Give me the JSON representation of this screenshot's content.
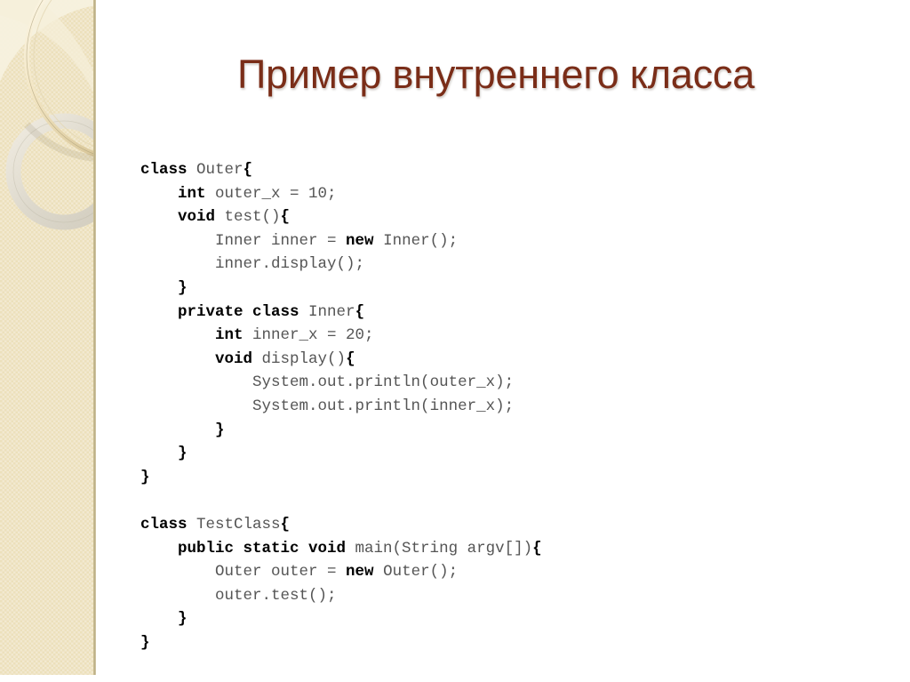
{
  "slide": {
    "title": "Пример внутреннего класса",
    "title_color": "#7a2d18",
    "background_color": "#ffffff"
  },
  "sidebar": {
    "name": "decorative-sidebar",
    "background_color": "#ece0bb",
    "edge_color": "#b9ad85",
    "ring_gold_color": "#f6edd2",
    "ring_gray_color": "#dedad0",
    "wedge_color": "#f5eedb"
  },
  "code_block": {
    "language": "java",
    "lines": [
      {
        "id": "l1",
        "indent": 0,
        "tokens": [
          {
            "t": "class",
            "b": true
          },
          {
            "t": " ",
            "b": false
          },
          {
            "t": "Outer",
            "b": false
          },
          {
            "t": "{",
            "b": true
          }
        ]
      },
      {
        "id": "l2",
        "indent": 1,
        "tokens": [
          {
            "t": "int",
            "b": true
          },
          {
            "t": " outer_x = 10;",
            "b": false
          }
        ]
      },
      {
        "id": "l3",
        "indent": 1,
        "tokens": [
          {
            "t": "void",
            "b": true
          },
          {
            "t": " test()",
            "b": false
          },
          {
            "t": "{",
            "b": true
          }
        ]
      },
      {
        "id": "l4",
        "indent": 2,
        "tokens": [
          {
            "t": "Inner inner = ",
            "b": false
          },
          {
            "t": "new",
            "b": true
          },
          {
            "t": " Inner();",
            "b": false
          }
        ]
      },
      {
        "id": "l5",
        "indent": 2,
        "tokens": [
          {
            "t": "inner.display();",
            "b": false
          }
        ]
      },
      {
        "id": "l6",
        "indent": 1,
        "tokens": [
          {
            "t": "}",
            "b": true
          }
        ]
      },
      {
        "id": "l7",
        "indent": 1,
        "tokens": [
          {
            "t": "private class",
            "b": true
          },
          {
            "t": " Inner",
            "b": false
          },
          {
            "t": "{",
            "b": true
          }
        ]
      },
      {
        "id": "l8",
        "indent": 2,
        "tokens": [
          {
            "t": "int",
            "b": true
          },
          {
            "t": " inner_x = 20;",
            "b": false
          }
        ]
      },
      {
        "id": "l9",
        "indent": 2,
        "tokens": [
          {
            "t": "void",
            "b": true
          },
          {
            "t": " display()",
            "b": false
          },
          {
            "t": "{",
            "b": true
          }
        ]
      },
      {
        "id": "l10",
        "indent": 3,
        "tokens": [
          {
            "t": "System.out.println(outer_x);",
            "b": false
          }
        ]
      },
      {
        "id": "l11",
        "indent": 3,
        "tokens": [
          {
            "t": "System.out.println(inner_x);",
            "b": false
          }
        ]
      },
      {
        "id": "l12",
        "indent": 2,
        "tokens": [
          {
            "t": "}",
            "b": true
          }
        ]
      },
      {
        "id": "l13",
        "indent": 1,
        "tokens": [
          {
            "t": "}",
            "b": true
          }
        ]
      },
      {
        "id": "l14",
        "indent": 0,
        "tokens": [
          {
            "t": "}",
            "b": true
          }
        ]
      },
      {
        "id": "l15",
        "indent": 0,
        "tokens": []
      },
      {
        "id": "l16",
        "indent": 0,
        "tokens": [
          {
            "t": "class",
            "b": true
          },
          {
            "t": " TestClass",
            "b": false
          },
          {
            "t": "{",
            "b": true
          }
        ]
      },
      {
        "id": "l17",
        "indent": 1,
        "tokens": [
          {
            "t": "public static void",
            "b": true
          },
          {
            "t": " main(String argv[])",
            "b": false
          },
          {
            "t": "{",
            "b": true
          }
        ]
      },
      {
        "id": "l18",
        "indent": 2,
        "tokens": [
          {
            "t": "Outer outer = ",
            "b": false
          },
          {
            "t": "new",
            "b": true
          },
          {
            "t": " Outer();",
            "b": false
          }
        ]
      },
      {
        "id": "l19",
        "indent": 2,
        "tokens": [
          {
            "t": "outer.test();",
            "b": false
          }
        ]
      },
      {
        "id": "l20",
        "indent": 1,
        "tokens": [
          {
            "t": "}",
            "b": true
          }
        ]
      },
      {
        "id": "l21",
        "indent": 0,
        "tokens": [
          {
            "t": "}",
            "b": true
          }
        ]
      }
    ],
    "plain_text": "class Outer{\n    int outer_x = 10;\n    void test(){\n        Inner inner = new Inner();\n        inner.display();\n    }\n    private class Inner{\n        int inner_x = 20;\n        void display(){\n            System.out.println(outer_x);\n            System.out.println(inner_x);\n        }\n    }\n}\n\nclass TestClass{\n    public static void main(String argv[]){\n        Outer outer = new Outer();\n        outer.test();\n    }\n}"
  }
}
